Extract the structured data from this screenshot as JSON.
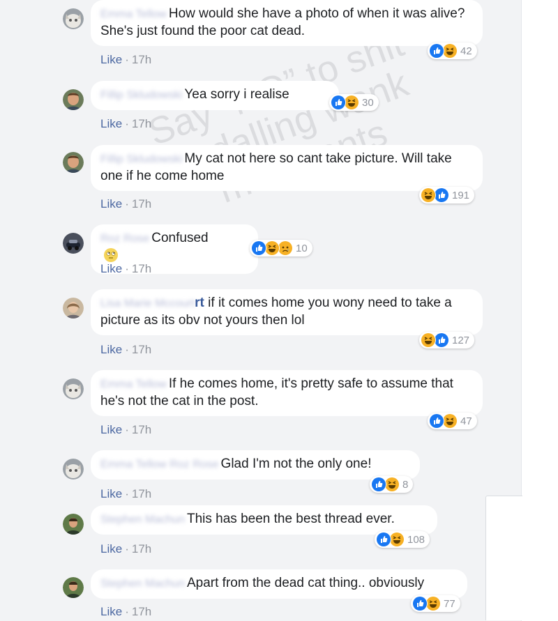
{
  "watermark": "Say “NO” to shit pedalling wank merchants",
  "like_label": "Like",
  "time": "17h",
  "comments": [
    {
      "author": "Emma Tellow",
      "text": "How would she have a photo of when it was alive? She's just found the poor cat dead.",
      "reaction_count": "42",
      "reactions": [
        "like-icon",
        "haha-icon"
      ]
    },
    {
      "author": "Fillip Skludowski",
      "text": "Yea sorry i realise",
      "reaction_count": "30",
      "reactions": [
        "like-icon",
        "haha-icon"
      ]
    },
    {
      "author": "Fillip Skludowski",
      "text": "My cat not here so cant take picture. Will take one if he come home",
      "reaction_count": "191",
      "reactions": [
        "haha-icon",
        "like-icon"
      ]
    },
    {
      "author": "Roz Rose",
      "text": "Confused",
      "reaction_count": "10",
      "reactions": [
        "like-icon",
        "haha-icon",
        "sad-icon"
      ]
    },
    {
      "author": "Lisa Marie Mccourt",
      "author_tail": "rt",
      "text": " if it comes home you wony need to take a picture as its obv not yours then lol",
      "reaction_count": "127",
      "reactions": [
        "haha-icon",
        "like-icon"
      ]
    },
    {
      "author": "Emma Tellow",
      "text": "If he comes home, it's pretty safe to assume that he's not the cat in the post.",
      "reaction_count": "47",
      "reactions": [
        "like-icon",
        "haha-icon"
      ]
    },
    {
      "author": "Emma Tellow Roz Rose",
      "text": "Glad I'm not the only one!",
      "reaction_count": "8",
      "reactions": [
        "like-icon",
        "haha-icon"
      ]
    },
    {
      "author": "Stephen Machun",
      "text": "This has been the best thread ever.",
      "reaction_count": "108",
      "reactions": [
        "like-icon",
        "haha-icon"
      ]
    },
    {
      "author": "Stephen Machun",
      "text": "Apart from the dead cat thing.. obviously",
      "reaction_count": "77",
      "reactions": [
        "like-icon",
        "haha-icon"
      ]
    }
  ],
  "colors": {
    "like_blue": "#1877f2",
    "haha_yellow": "#f7b125",
    "link_blue": "#4b67a1",
    "meta_grey": "#90949c"
  }
}
